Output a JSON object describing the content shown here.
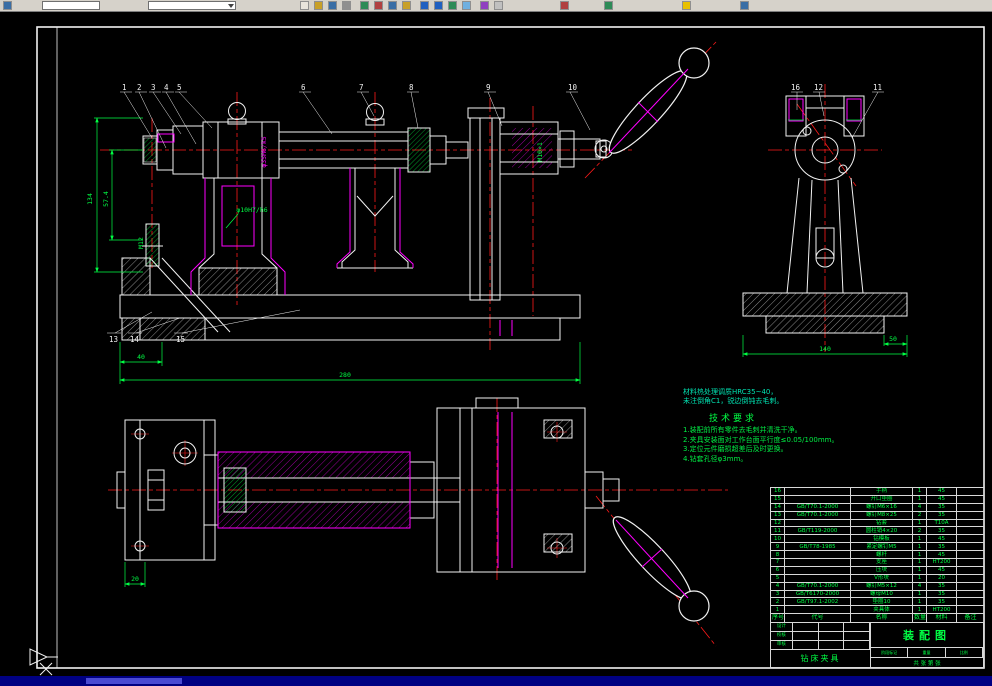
{
  "toolbar": {
    "icons": [
      "app",
      "new",
      "open",
      "save",
      "print",
      "preview",
      "cut",
      "copy",
      "paste",
      "undo",
      "redo",
      "zoom-in",
      "zoom-out",
      "pan",
      "layers",
      "plot",
      "properties",
      "help",
      "grid"
    ]
  },
  "drawing": {
    "callouts": {
      "top": [
        "1",
        "2",
        "3",
        "4",
        "5",
        "6",
        "7",
        "8",
        "9",
        "10"
      ],
      "side": [
        "16",
        "12",
        "11"
      ],
      "bottom": [
        "13",
        "14",
        "15"
      ]
    },
    "dims": {
      "front_height_outer": "134",
      "front_height_inner": "57.4",
      "front_width_small": "40",
      "front_width_total": "280",
      "fit_label": "φ10H7/h6",
      "shaft_fit": "φ35H6/k5",
      "thread_clamp": "M10×1",
      "thread_left": "M12",
      "side_width_total": "140",
      "side_width_step": "50",
      "plan_step": "20"
    },
    "notes": {
      "pre": [
        "材料热处理调质HRC35~40，",
        "未注倒角C1，锐边倒钝去毛刺。"
      ],
      "heading": "技术要求",
      "items": [
        "1.装配前所有零件去毛刺并清洗干净。",
        "2.夹具安装面对工作台面平行度≤0.05/100mm。",
        "3.定位元件磨损超差后及时更换。",
        "4.钻套孔径φ3mm。"
      ]
    },
    "bom": {
      "headers": [
        "序号",
        "代号",
        "名称",
        "数量",
        "材料",
        "备注"
      ],
      "rows": [
        [
          "16",
          "",
          "手柄",
          "1",
          "45",
          ""
        ],
        [
          "15",
          "",
          "开口垫圈",
          "1",
          "45",
          ""
        ],
        [
          "14",
          "GB/T70.1-2000",
          "螺钉M6×16",
          "4",
          "35",
          ""
        ],
        [
          "13",
          "GB/T70.1-2000",
          "螺钉M8×25",
          "2",
          "35",
          ""
        ],
        [
          "12",
          "",
          "钻套",
          "1",
          "T10A",
          ""
        ],
        [
          "11",
          "GB/T119-2000",
          "圆柱销4×20",
          "2",
          "35",
          ""
        ],
        [
          "10",
          "",
          "钻模板",
          "1",
          "45",
          ""
        ],
        [
          "9",
          "GB/T78-1985",
          "紧定螺钉M5",
          "1",
          "35",
          ""
        ],
        [
          "8",
          "",
          "螺杆",
          "1",
          "45",
          ""
        ],
        [
          "7",
          "",
          "支座",
          "1",
          "HT200",
          ""
        ],
        [
          "6",
          "",
          "压块",
          "1",
          "45",
          ""
        ],
        [
          "5",
          "",
          "V形块",
          "1",
          "20",
          ""
        ],
        [
          "4",
          "GB/T70.1-2000",
          "螺钉M5×12",
          "4",
          "35",
          ""
        ],
        [
          "3",
          "GB/T6170-2000",
          "螺母M10",
          "1",
          "35",
          ""
        ],
        [
          "2",
          "GB/T97.1-2002",
          "垫圈10",
          "1",
          "35",
          ""
        ],
        [
          "1",
          "",
          "夹具体",
          "1",
          "HT200",
          ""
        ]
      ]
    },
    "titleblock": {
      "title": "装配图",
      "subtitle": "钻床夹具",
      "left_labels": [
        "设计",
        "校核",
        "审核"
      ],
      "mid_labels": [
        "阶段标记",
        "重量",
        "比例"
      ],
      "sheet_label": "共 张 第 张"
    }
  }
}
